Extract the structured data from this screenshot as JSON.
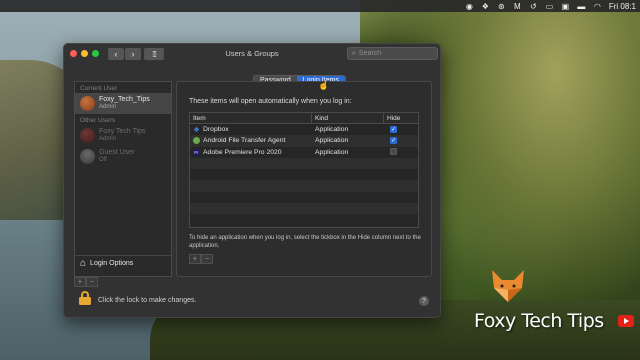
{
  "menubar": {
    "clock": "Fri 08:1",
    "icons": [
      "record-icon",
      "dropbox-icon",
      "wifi-ext-icon",
      "malwarebytes-icon",
      "history-icon",
      "control-strip-icon",
      "airplay-icon",
      "battery-icon",
      "wifi-icon"
    ]
  },
  "window": {
    "title": "Users & Groups",
    "search_placeholder": "Search"
  },
  "sidebar": {
    "current_user_header": "Current User",
    "current_user": {
      "name": "Foxy_Tech_Tips",
      "role": "Admin"
    },
    "other_users_header": "Other Users",
    "other_users": [
      {
        "name": "Foxy Tech Tips",
        "role": "Admin"
      },
      {
        "name": "Guest User",
        "role": "Off"
      }
    ],
    "login_options": "Login Options",
    "add": "+",
    "remove": "−"
  },
  "tabs": [
    {
      "label": "Password",
      "active": false
    },
    {
      "label": "Login Items",
      "active": true
    }
  ],
  "login_items": {
    "intro": "These items will open automatically when you log in:",
    "columns": {
      "item": "Item",
      "kind": "Kind",
      "hide": "Hide"
    },
    "rows": [
      {
        "name": "Dropbox",
        "kind": "Application",
        "hide": true,
        "icon": "dropbox-icon"
      },
      {
        "name": "Android File Transfer Agent",
        "kind": "Application",
        "hide": true,
        "icon": "android-icon"
      },
      {
        "name": "Adobe Premiere Pro 2020",
        "kind": "Application",
        "hide": false,
        "icon": "premiere-icon"
      }
    ],
    "hint": "To hide an application when you log in, select the tickbox in the Hide column next to the application.",
    "add": "+",
    "remove": "−"
  },
  "footer": {
    "lock_text": "Click the lock to make changes.",
    "help": "?"
  },
  "watermark": {
    "text": "Foxy Tech Tips"
  },
  "colors": {
    "accent": "#2c6cd6",
    "lock": "#e5a832",
    "window_bg": "#323232"
  }
}
